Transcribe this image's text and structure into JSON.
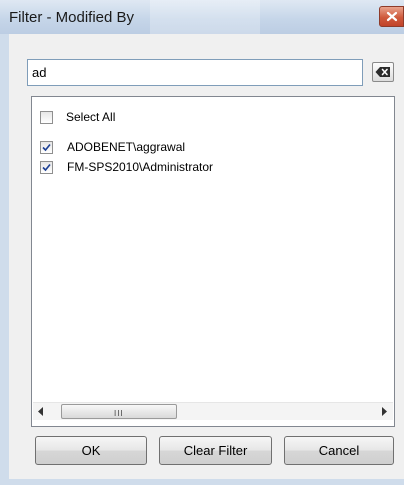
{
  "window": {
    "title": "Filter - Modified By",
    "close_icon": "close-icon"
  },
  "search": {
    "value": "ad",
    "clear_icon": "backspace-icon"
  },
  "list": {
    "select_all": {
      "label": "Select All",
      "checked": false
    },
    "items": [
      {
        "label": "ADOBENET\\aggrawal",
        "checked": true
      },
      {
        "label": "FM-SPS2010\\Administrator",
        "checked": true
      }
    ]
  },
  "scrollbar": {
    "left_icon": "scroll-left-icon",
    "right_icon": "scroll-right-icon",
    "grip": "III"
  },
  "buttons": {
    "ok": "OK",
    "clear_filter": "Clear Filter",
    "cancel": "Cancel"
  },
  "colors": {
    "frame": "#cfdceb",
    "close_button": "#cf5a3c",
    "checkmark": "#1c3f94"
  }
}
